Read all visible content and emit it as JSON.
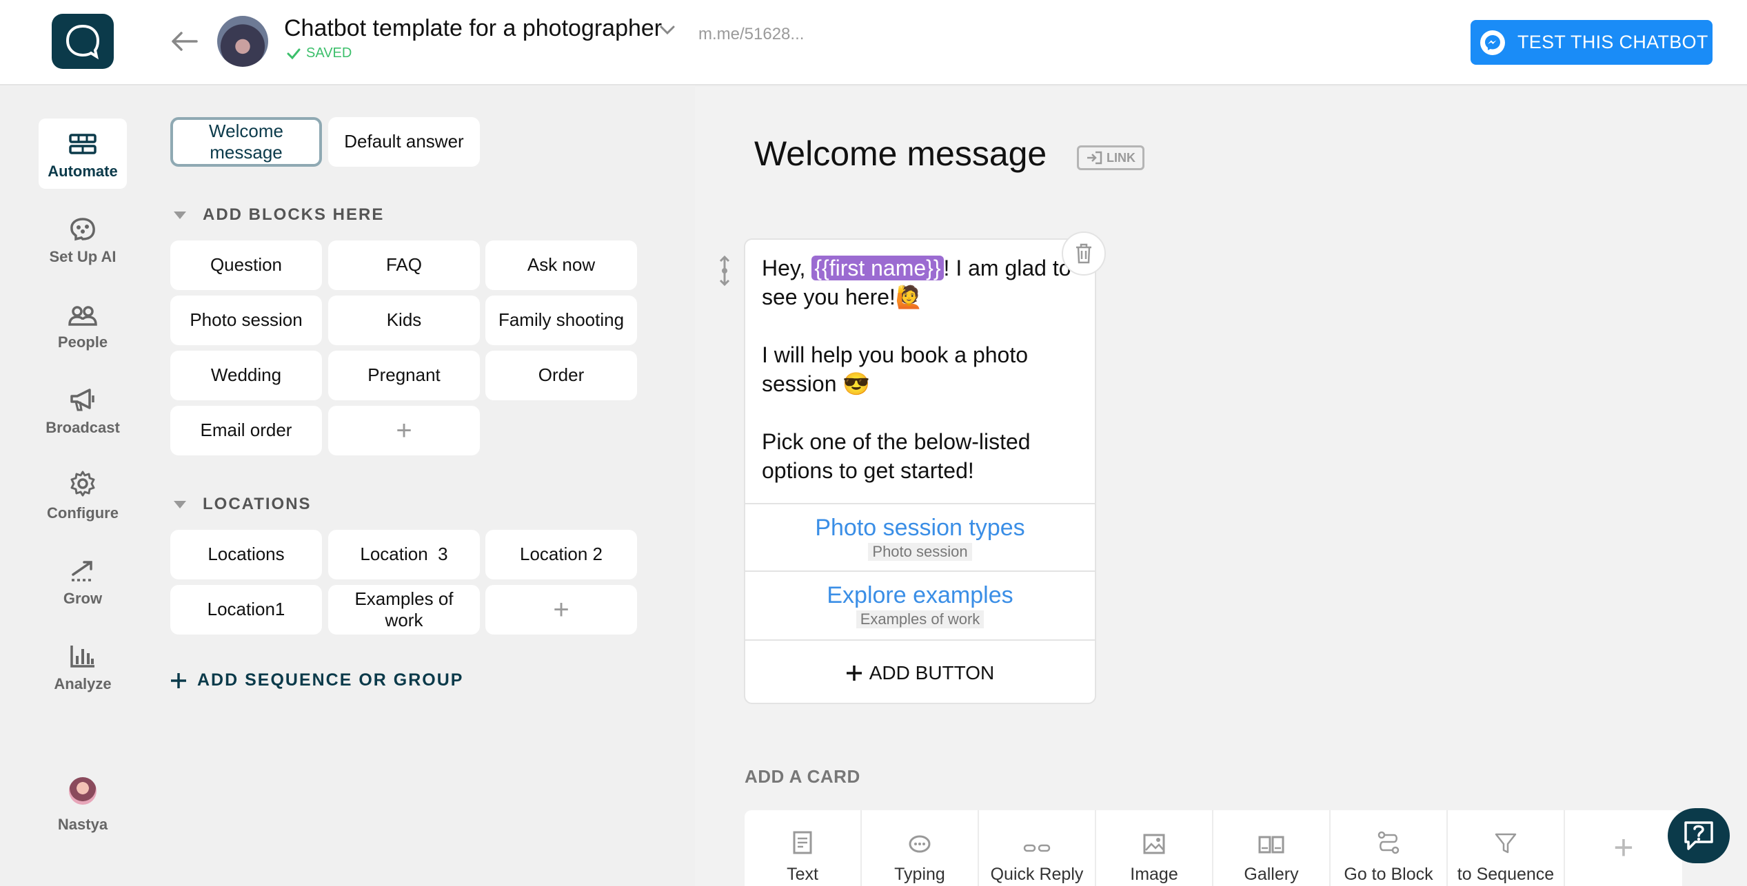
{
  "header": {
    "bot_title": "Chatbot template for a photographer",
    "saved_label": "SAVED",
    "link_text": "m.me/51628...",
    "test_button": "TEST THIS CHATBOT"
  },
  "nav": {
    "items": [
      {
        "label": "Automate",
        "icon": "flow-icon"
      },
      {
        "label": "Set Up AI",
        "icon": "brain-icon"
      },
      {
        "label": "People",
        "icon": "people-icon"
      },
      {
        "label": "Broadcast",
        "icon": "megaphone-icon"
      },
      {
        "label": "Configure",
        "icon": "gear-icon"
      },
      {
        "label": "Grow",
        "icon": "growth-icon"
      },
      {
        "label": "Analyze",
        "icon": "bar-chart-icon"
      }
    ],
    "user_name": "Nastya"
  },
  "blocks": {
    "top": [
      "Welcome message",
      "Default answer"
    ],
    "section1_title": "ADD BLOCKS HERE",
    "section1": [
      "Question",
      "FAQ",
      "Ask now",
      "Photo session",
      "Kids",
      "Family shooting",
      "Wedding",
      "Pregnant",
      "Order",
      "Email order"
    ],
    "section2_title": "LOCATIONS",
    "section2": [
      "Locations",
      "Location  3",
      "Location 2",
      "Location1",
      "Examples of work"
    ],
    "add_sequence": "ADD SEQUENCE OR GROUP"
  },
  "editor": {
    "title": "Welcome message",
    "link_badge": "LINK",
    "card": {
      "text_before": "Hey, ",
      "variable": "{{first name}}",
      "text_after": "! I am glad to see you here!🙋",
      "para2": "I will help you book a photo session 😎",
      "para3": "Pick one of the below-listed options to get started!",
      "buttons": [
        {
          "title": "Photo session types",
          "target": "Photo session"
        },
        {
          "title": "Explore examples",
          "target": "Examples of work"
        }
      ],
      "add_button": "ADD BUTTON"
    },
    "add_card_label": "ADD A CARD",
    "tools": [
      "Text",
      "Typing",
      "Quick Reply",
      "Image",
      "Gallery",
      "Go to Block",
      "to Sequence"
    ]
  }
}
